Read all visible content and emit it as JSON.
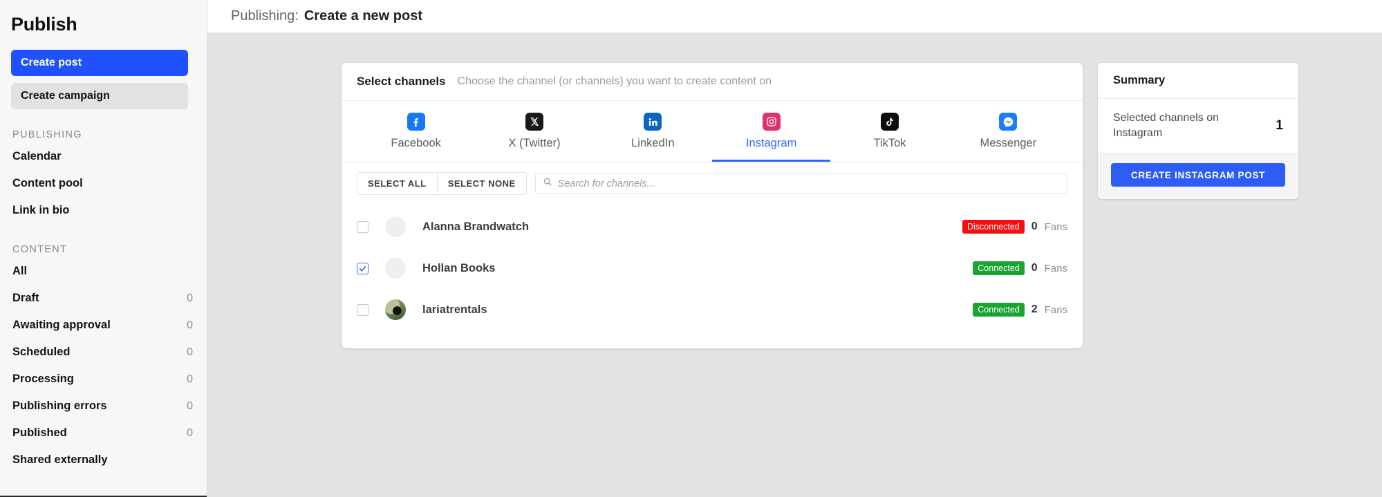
{
  "sidebar": {
    "brand": "Publish",
    "buttons": [
      {
        "label": "Create post",
        "style": "primary"
      },
      {
        "label": "Create campaign",
        "style": "secondary"
      }
    ],
    "groups": [
      {
        "label": "PUBLISHING",
        "items": [
          {
            "label": "Calendar",
            "count": ""
          },
          {
            "label": "Content pool",
            "count": ""
          },
          {
            "label": "Link in bio",
            "count": ""
          }
        ]
      },
      {
        "label": "CONTENT",
        "items": [
          {
            "label": "All",
            "count": ""
          },
          {
            "label": "Draft",
            "count": "0"
          },
          {
            "label": "Awaiting approval",
            "count": "0"
          },
          {
            "label": "Scheduled",
            "count": "0"
          },
          {
            "label": "Processing",
            "count": "0"
          },
          {
            "label": "Publishing errors",
            "count": "0"
          },
          {
            "label": "Published",
            "count": "0"
          },
          {
            "label": "Shared externally",
            "count": ""
          }
        ]
      }
    ]
  },
  "topbar": {
    "breadcrumb_prefix": "Publishing:",
    "breadcrumb_title": "Create a new post"
  },
  "select_channels": {
    "heading": "Select channels",
    "subheading": "Choose the channel (or channels) you want to create content on",
    "tabs": [
      {
        "label": "Facebook",
        "icon": "facebook-icon",
        "active": false
      },
      {
        "label": "X (Twitter)",
        "icon": "x-twitter-icon",
        "active": false
      },
      {
        "label": "LinkedIn",
        "icon": "linkedin-icon",
        "active": false
      },
      {
        "label": "Instagram",
        "icon": "instagram-icon",
        "active": true
      },
      {
        "label": "TikTok",
        "icon": "tiktok-icon",
        "active": false
      },
      {
        "label": "Messenger",
        "icon": "messenger-icon",
        "active": false
      }
    ],
    "select_all_label": "SELECT ALL",
    "select_none_label": "SELECT NONE",
    "search_placeholder": "Search for channels...",
    "search_value": "",
    "search_icon": "search-icon",
    "fans_label": "Fans",
    "channels": [
      {
        "name": "Alanna Brandwatch",
        "checked": false,
        "status": "Disconnected",
        "status_kind": "disconnected",
        "fans": "0",
        "avatar": "placeholder"
      },
      {
        "name": "Hollan Books",
        "checked": true,
        "status": "Connected",
        "status_kind": "connected",
        "fans": "0",
        "avatar": "placeholder"
      },
      {
        "name": "lariatrentals",
        "checked": false,
        "status": "Connected",
        "status_kind": "connected",
        "fans": "2",
        "avatar": "photo"
      }
    ]
  },
  "summary": {
    "title": "Summary",
    "row_label": "Selected channels on Instagram",
    "row_value": "1",
    "cta_label": "CREATE INSTAGRAM POST"
  },
  "colors": {
    "accent_blue": "#1f51ff",
    "tab_blue": "#3366ff",
    "cta_blue": "#2d5cf6",
    "connected_green": "#1aa332",
    "disconnected_red": "#f5100f",
    "page_bg": "#e3e3e3",
    "sidebar_bg": "#f7f7f7"
  }
}
